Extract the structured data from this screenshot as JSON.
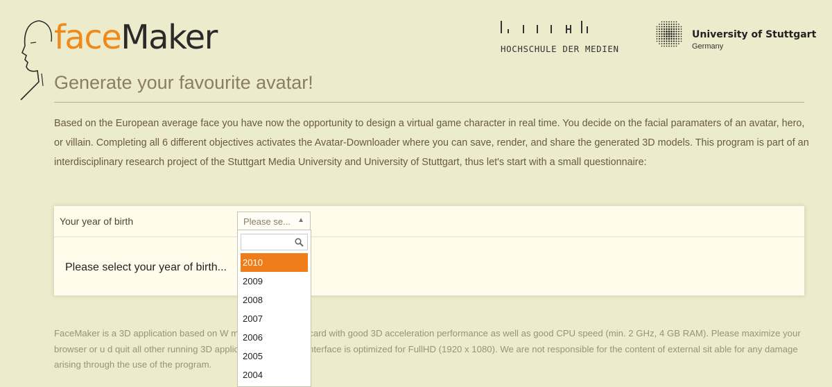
{
  "brand": {
    "logo_face": "face",
    "logo_maker": "Maker",
    "tagline": "Generate your favourite avatar!"
  },
  "partners": {
    "hdm": "HOCHSCHULE DER MEDIEN",
    "uni_name": "University of Stuttgart",
    "uni_country": "Germany"
  },
  "intro": "Based on the European average face you have now the opportunity to design a virtual game character in real time. You decide on the facial paramaters of an avatar, hero, or villain. Completing all 6 different objectives activates the Avatar-Downloader where you can save, render, and share the generated 3D models. This program is part of an interdisciplinary research project of the Stuttgart Media University and University of Stuttgart, thus let's start with a small questionnaire:",
  "questionnaire": {
    "label": "Your year of birth",
    "select_value": "Please se...",
    "message": "Please select your year of birth...",
    "dropdown": {
      "search_value": "",
      "highlighted": "2010",
      "options": [
        "2010",
        "2009",
        "2008",
        "2007",
        "2006",
        "2005",
        "2004"
      ]
    }
  },
  "footer": "FaceMaker is a 3D application based on W                      mmend a graphics card with good 3D acceleration performance as well as good CPU speed (min. 2 GHz, 4 GB RAM). Please maximize your browser or u                       d quit all other running 3D applications. The user interface is optimized for FullHD (1920 x 1080). We are not responsible for the content of external sit                      able for any damage arising through the use of the program.",
  "colors": {
    "background": "#ecebcb",
    "accent": "#ee8a1c",
    "highlight": "#ee7d1a"
  }
}
